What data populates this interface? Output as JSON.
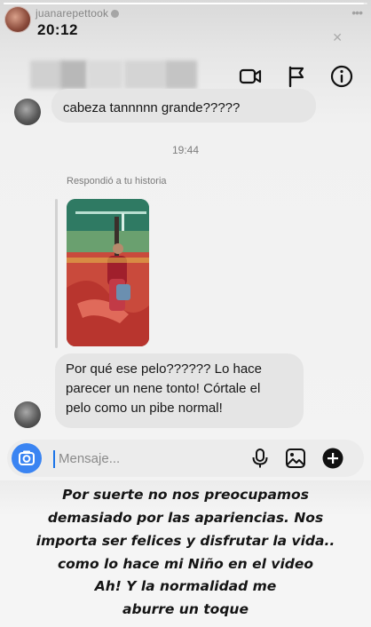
{
  "story": {
    "username": "juanarepettook",
    "time": "20:12",
    "progress": 0.99
  },
  "chat": {
    "partial_message": "cabeza tannnnn grande?????",
    "timestamp": "19:44",
    "replied_label": "Respondió a tu historia",
    "message_lines": [
      "Por qué ese pelo??????  Lo hace",
      "parecer un nene tonto! Córtale el",
      "pelo como un pibe normal!"
    ]
  },
  "composer": {
    "placeholder": "Mensaje..."
  },
  "caption": {
    "lines": [
      "Por suerte no nos preocupamos",
      "demasiado por las apariencias. Nos",
      "importa ser felices y disfrutar la vida..",
      "como lo hace mi Niño en el video",
      "Ah! Y la normalidad me",
      "aburre un toque"
    ]
  },
  "icons": {
    "video": "video-call-icon",
    "flag": "flag-icon",
    "info": "info-icon",
    "camera": "camera-icon",
    "mic": "microphone-icon",
    "gallery": "gallery-icon",
    "add": "add-icon"
  },
  "colors": {
    "accent": "#3a84f2",
    "bubble": "#e5e5e5",
    "caption_text": "#141414"
  }
}
